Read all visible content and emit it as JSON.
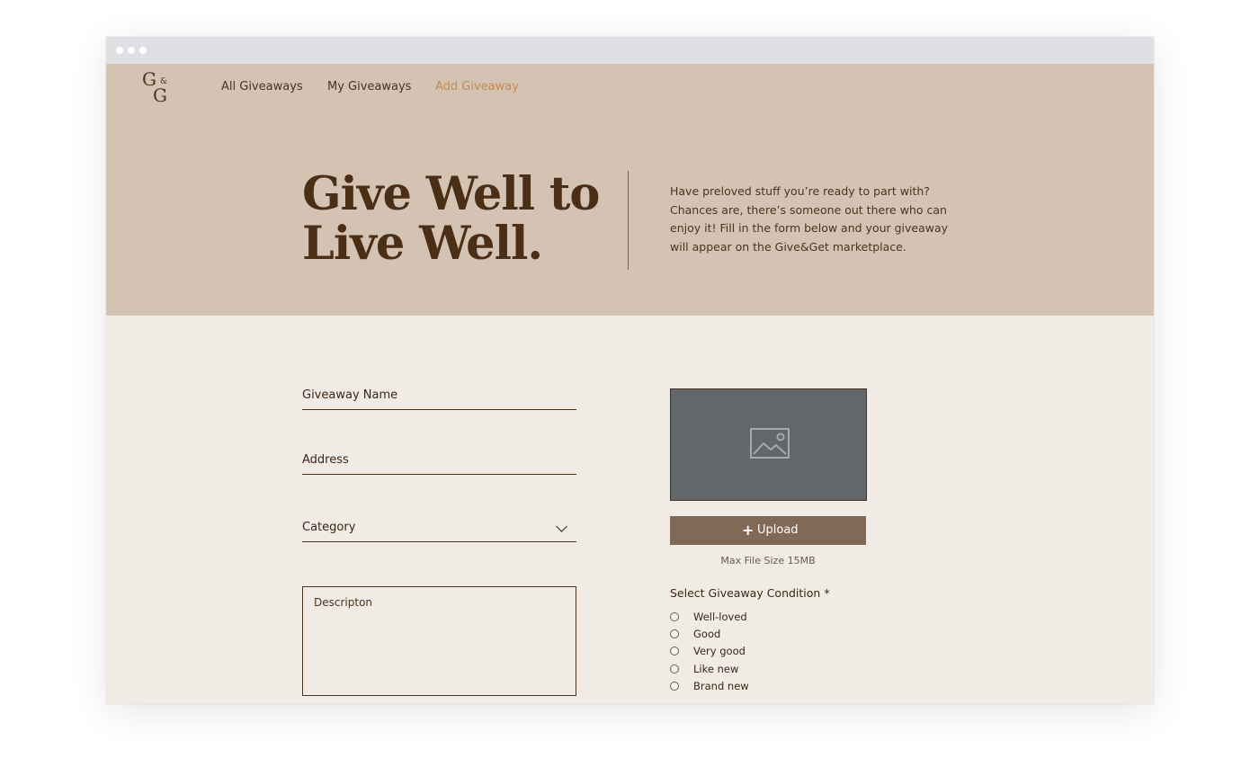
{
  "brand": {
    "logo_g1": "G",
    "logo_amp": "&",
    "logo_g2": "G"
  },
  "nav": {
    "items": [
      {
        "label": "All Giveaways"
      },
      {
        "label": "My Giveaways"
      },
      {
        "label": "Add Giveaway"
      }
    ],
    "active_color": "#c58a55"
  },
  "hero": {
    "headline_line1": "Give Well to",
    "headline_line2": "Live Well.",
    "intro": "Have preloved stuff you’re ready to part with? Chances are, there’s someone out there who can enjoy it! Fill in the form below and your giveaway will appear on the Give&Get marketplace."
  },
  "form": {
    "name_label": "Giveaway Name",
    "address_label": "Address",
    "category_label": "Category",
    "description_placeholder": "Descripton"
  },
  "media": {
    "image_icon": "image-icon",
    "upload_label": "Upload",
    "max_size": "Max File Size 15MB"
  },
  "condition": {
    "title": "Select Giveaway Condition *",
    "options": [
      {
        "label": "Well-loved"
      },
      {
        "label": "Good"
      },
      {
        "label": "Very good"
      },
      {
        "label": "Like new"
      },
      {
        "label": "Brand new"
      }
    ]
  },
  "colors": {
    "hero_bg": "#d4c3b2",
    "page_bg": "#f0ebe4",
    "text_dark": "#4a2e16",
    "upload_bg": "#816a55",
    "image_bg": "#63676a"
  }
}
